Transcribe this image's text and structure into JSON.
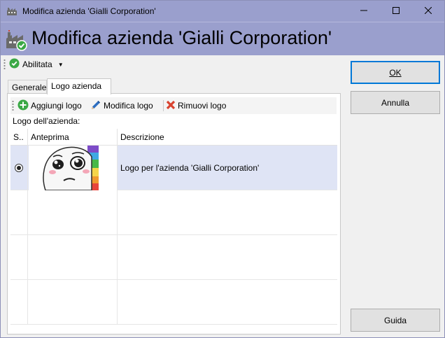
{
  "window": {
    "title": "Modifica azienda 'Gialli Corporation'",
    "icon": "factory-icon",
    "controls": [
      "minimize-icon",
      "maximize-icon",
      "close-icon"
    ]
  },
  "header": {
    "title": "Modifica azienda 'Gialli Corporation'",
    "icon": "factory-edit-icon"
  },
  "toolbar": {
    "status_label": "Abilitata",
    "status_icon": "check-circle-icon"
  },
  "tabs": [
    {
      "label": "Generale",
      "active": false
    },
    {
      "label": "Logo azienda",
      "active": true
    }
  ],
  "logo_toolbar": {
    "add_label": "Aggiungi logo",
    "edit_label": "Modifica logo",
    "remove_label": "Rimuovi logo"
  },
  "logo_grid": {
    "label": "Logo dell'azienda:",
    "columns": [
      "S..",
      "Anteprima",
      "Descrizione"
    ],
    "rows": [
      {
        "selected": true,
        "preview": "meme-face-logo-image",
        "description": "Logo per l'azienda 'Gialli Corporation'"
      }
    ]
  },
  "buttons": {
    "ok": "OK",
    "cancel": "Annulla",
    "help": "Guida"
  },
  "colors": {
    "title_bar": "#9a9fcd",
    "selection": "#dfe4f5",
    "default_button_border": "#0078d7",
    "check_green": "#3aa845",
    "remove_red": "#d9432f"
  }
}
